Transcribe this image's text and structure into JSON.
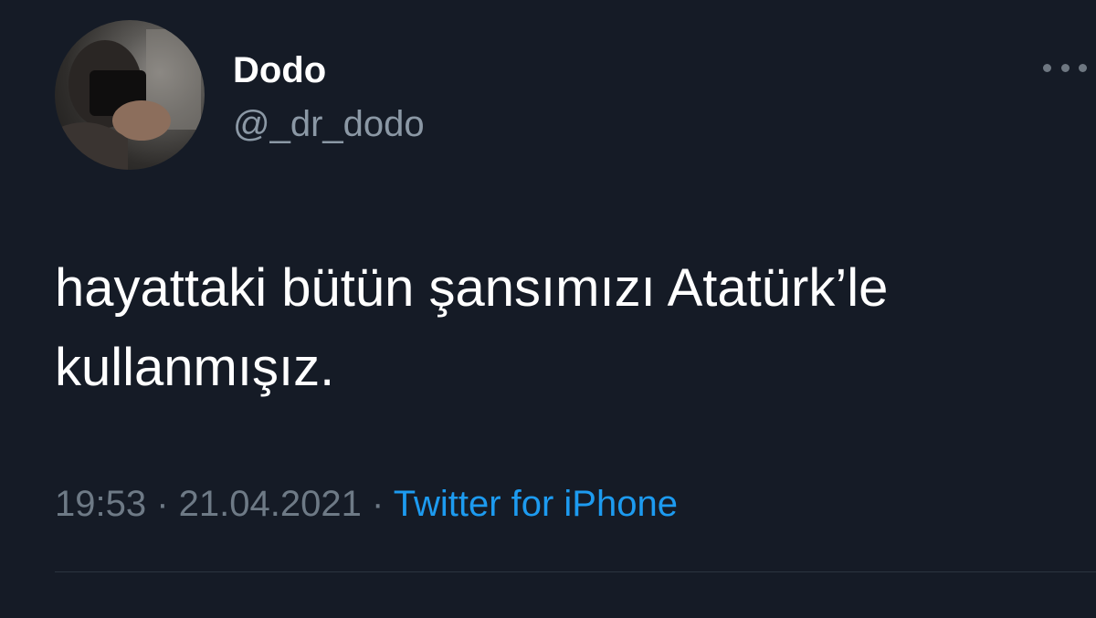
{
  "author": {
    "display_name": "Dodo",
    "handle": "@_dr_dodo"
  },
  "tweet": {
    "text": "hayattaki bütün şansımızı Atatürk’le\nkullanmışız."
  },
  "meta": {
    "time": "19:53",
    "separator": "·",
    "date": "21.04.2021",
    "source": "Twitter for iPhone"
  },
  "colors": {
    "background": "#151b26",
    "text": "#ffffff",
    "secondary": "#8b98a5",
    "link": "#1d9bf0"
  },
  "icons": {
    "more": "more-horizontal-icon"
  }
}
